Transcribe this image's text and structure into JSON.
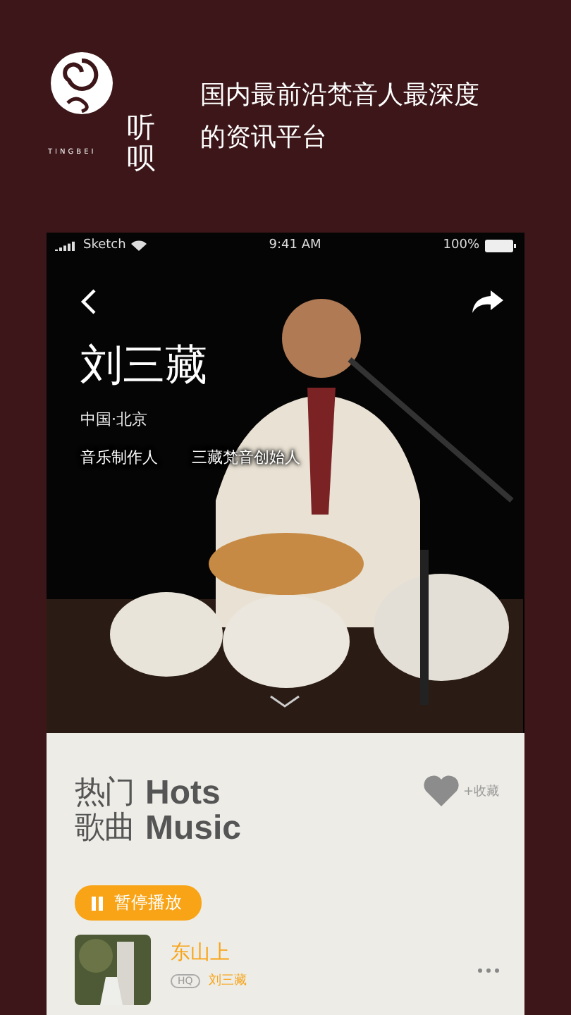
{
  "brand": {
    "logo_text": "听呗",
    "logo_latin": "TINGBEI"
  },
  "tagline": "国内最前沿梵音人最深度的资讯平台",
  "status_bar": {
    "carrier": "Sketch",
    "time": "9:41 AM",
    "battery": "100%"
  },
  "artist": {
    "name": "刘三藏",
    "location": "中国·北京",
    "roles": [
      "音乐制作人",
      "三藏梵音创始人"
    ]
  },
  "section": {
    "title_cn": [
      "热门",
      "歌曲"
    ],
    "title_en": [
      "Hots",
      "Music"
    ],
    "favorite": "+收藏"
  },
  "play_button": {
    "label": "暂停播放"
  },
  "songs": [
    {
      "title": "东山上",
      "quality": "HQ",
      "artist": "刘三藏"
    }
  ]
}
